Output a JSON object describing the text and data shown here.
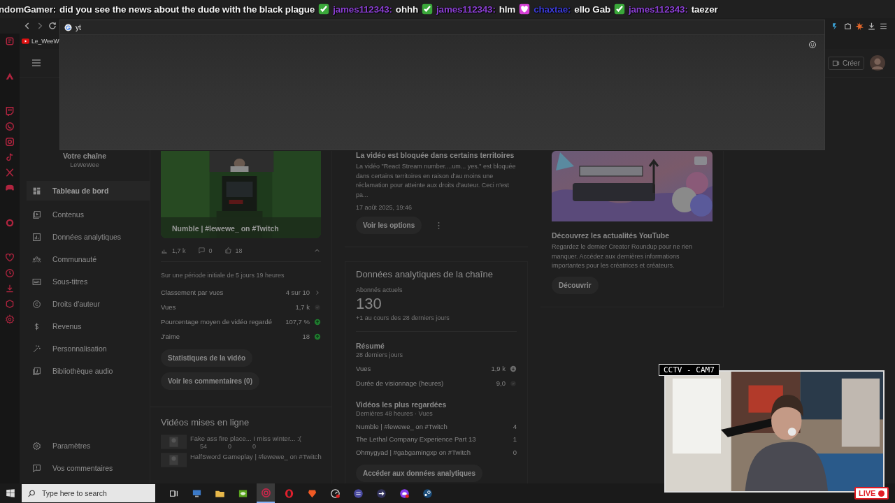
{
  "chat_overlay": {
    "messages": [
      {
        "user": "ndomGamer:",
        "color": "#e6e6e6",
        "text": "did you see the news about the dude with the black plague"
      },
      {
        "kind": "check",
        "user": "james112343:",
        "color": "#8a3fd1",
        "text": "ohhh"
      },
      {
        "kind": "check",
        "user": "james112343:",
        "color": "#8a3fd1",
        "text": "hlm"
      },
      {
        "kind": "heart",
        "user": "chaxtae:",
        "color": "#3b3bd6",
        "text": "ello Gab"
      },
      {
        "kind": "check",
        "user": "james112343:",
        "color": "#8a3fd1",
        "text": "taezer"
      }
    ]
  },
  "browser": {
    "address": {
      "value": "yt"
    },
    "bookmarks": [
      {
        "label": "Le_WeeW"
      }
    ]
  },
  "studio": {
    "create_button": "Créer",
    "sidebar": {
      "channel_label": "Votre chaîne",
      "channel_name": "LeWeWee",
      "items": [
        {
          "kind": "dashboard",
          "label": "Tableau de bord",
          "selected": true
        },
        {
          "kind": "content",
          "label": "Contenus",
          "selected": false
        },
        {
          "kind": "analytics",
          "label": "Données analytiques",
          "selected": false
        },
        {
          "kind": "community",
          "label": "Communauté",
          "selected": false
        },
        {
          "kind": "subtitles",
          "label": "Sous-titres",
          "selected": false
        },
        {
          "kind": "copyright",
          "label": "Droits d'auteur",
          "selected": false
        },
        {
          "kind": "revenue",
          "label": "Revenus",
          "selected": false
        },
        {
          "kind": "customize",
          "label": "Personnalisation",
          "selected": false
        },
        {
          "kind": "audio",
          "label": "Bibliothèque audio",
          "selected": false
        }
      ],
      "footer": [
        {
          "kind": "settings",
          "label": "Paramètres"
        },
        {
          "kind": "feedback",
          "label": "Vos commentaires"
        }
      ]
    },
    "latest_video": {
      "title": "Numble | #lewewe_ on #Twitch",
      "views": "1,7 k",
      "comments": "0",
      "likes": "18",
      "period": "Sur une période initiale de 5 jours 19 heures",
      "stats": [
        {
          "label": "Classement par vues",
          "value": "4 sur 10",
          "kind": "link"
        },
        {
          "label": "Vues",
          "value": "1,7 k",
          "kind": "neutral"
        },
        {
          "label": "Pourcentage moyen de vidéo regardé",
          "value": "107,7 %",
          "kind": "up"
        },
        {
          "label": "J'aime",
          "value": "18",
          "kind": "up"
        }
      ],
      "buttons": [
        "Statistiques de la vidéo",
        "Voir les commentaires (0)"
      ]
    },
    "published": {
      "title": "Vidéos mises en ligne",
      "videos": [
        {
          "title": "Fake ass fire place... I miss winter... :(",
          "views": "54",
          "comments": "0",
          "likes": "0"
        },
        {
          "title": "HalfSword Gameplay | #lewewe_ on #Twitch"
        }
      ]
    },
    "notice": {
      "title": "La vidéo est bloquée dans certains territoires",
      "text": "La vidéo \"React Stream number....um... yes.\" est bloquée dans certains territoires en raison d'au moins une réclamation pour atteinte aux droits d'auteur. Ceci n'est pa...",
      "date": "17 août 2025, 19:46",
      "button": "Voir les options"
    },
    "analytics": {
      "title": "Données analytiques de la chaîne",
      "subscribers_label": "Abonnés actuels",
      "subscribers": "130",
      "subscribers_change": "+1 au cours des 28 derniers jours",
      "summary_title": "Résumé",
      "summary_period": "28 derniers jours",
      "summary": [
        {
          "label": "Vues",
          "value": "1,9 k",
          "kind": "down"
        },
        {
          "label": "Durée de visionnage (heures)",
          "value": "9,0",
          "kind": "neutral"
        }
      ],
      "top_title": "Vidéos les plus regardées",
      "top_period": "Dernières 48 heures · Vues",
      "top_videos": [
        {
          "title": "Numble | #lewewe_ on #Twitch",
          "views": "4"
        },
        {
          "title": "The Lethal Company Experience Part 13",
          "views": "1"
        },
        {
          "title": "Ohmygyad | #gabgamingxp on #Twitch",
          "views": "0"
        }
      ],
      "button": "Accéder aux données analytiques"
    },
    "news": {
      "kind": "picture",
      "title": "Découvrez les actualités YouTube",
      "text": "Regardez le dernier Creator Roundup pour ne rien manquer. Accédez aux dernières informations importantes pour les créatrices et créateurs.",
      "button": "Découvrir"
    }
  },
  "webcam": {
    "label": "CCTV - CAM7",
    "live": "LIVE"
  },
  "taskbar": {
    "search_placeholder": "Type here to search",
    "apps": [
      {
        "kind": "taskview",
        "selected": false
      },
      {
        "kind": "monitor",
        "selected": false
      },
      {
        "kind": "folder",
        "selected": false
      },
      {
        "kind": "green",
        "selected": false
      },
      {
        "kind": "ring",
        "selected": true
      },
      {
        "kind": "opera",
        "selected": false
      },
      {
        "kind": "lion",
        "selected": false
      },
      {
        "kind": "gauge",
        "selected": false
      },
      {
        "kind": "keyboard",
        "selected": false
      },
      {
        "kind": "arrow",
        "selected": false
      },
      {
        "kind": "gamepad",
        "selected": false
      },
      {
        "kind": "steam",
        "selected": false
      }
    ]
  }
}
